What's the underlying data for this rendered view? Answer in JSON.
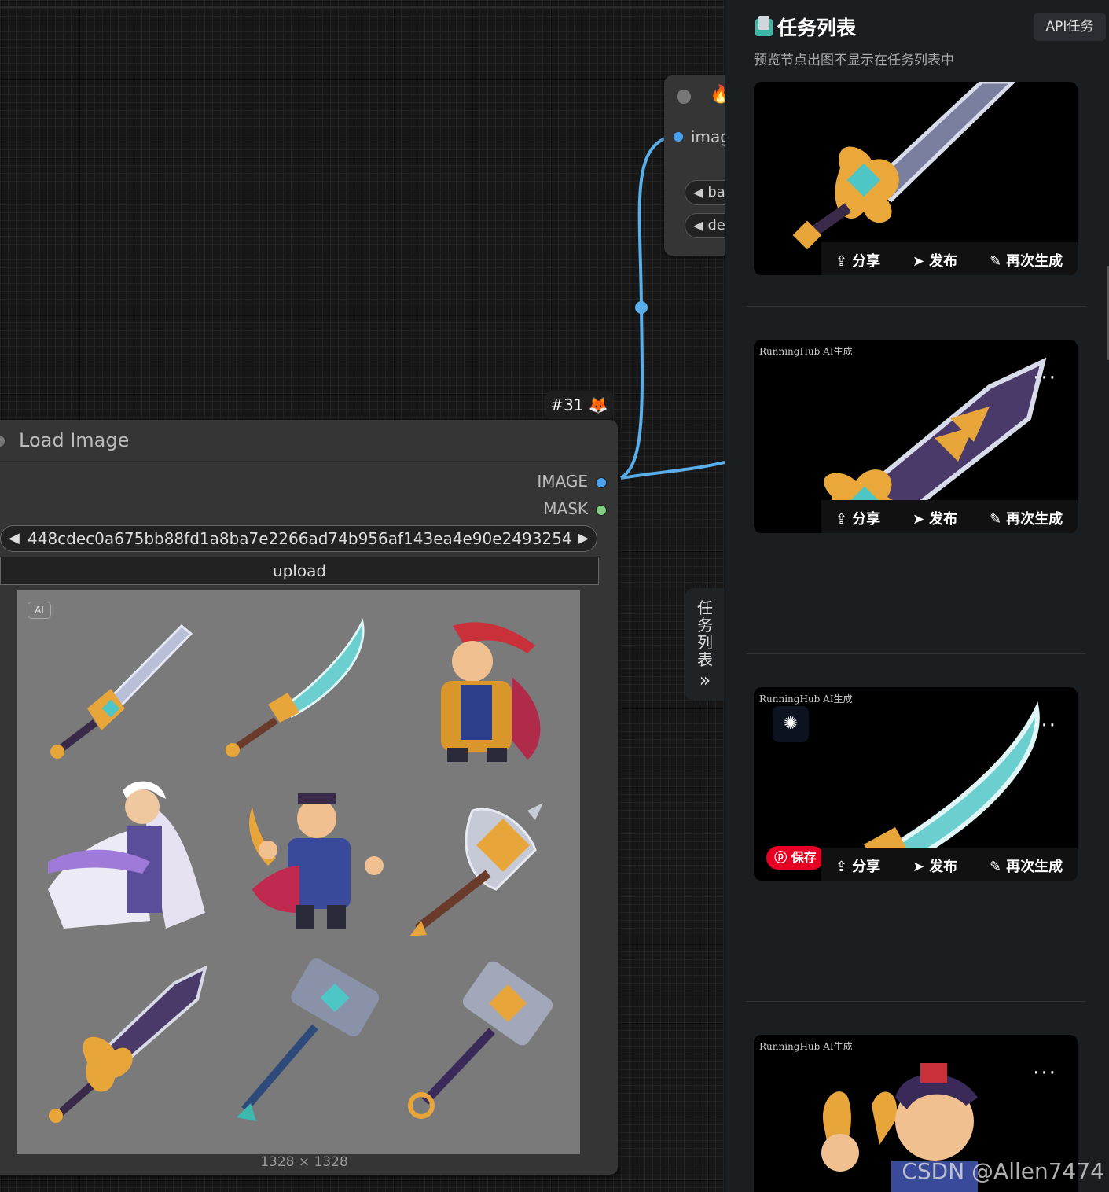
{
  "canvas": {
    "top_node": {
      "input_label": "imag",
      "pill1": "ba",
      "pill2": "de"
    },
    "node_badge": "#31 🦊",
    "load_image": {
      "title": "Load Image",
      "outputs": [
        {
          "label": "IMAGE",
          "color": "#4aa3f0"
        },
        {
          "label": "MASK",
          "color": "#7fcf7f"
        }
      ],
      "filename": "448cdec0a675bb88fd1a8ba7e2266ad74b956af143ea4e90e2493254",
      "filename_ellipsis": "...",
      "upload_label": "upload",
      "ai_badge": "AI",
      "dimensions": "1328 × 1328"
    },
    "side_tab": {
      "label": "任务列表",
      "chars": [
        "任",
        "务",
        "列",
        "表"
      ],
      "chevron": "»"
    }
  },
  "panel": {
    "title": "任务列表",
    "api_button": "API任务",
    "subtitle": "预览节点出图不显示在任务列表中",
    "brand_text": "RunningHub AI生成",
    "actions": {
      "share": "分享",
      "publish": "发布",
      "regenerate": "再次生成"
    },
    "save_label": "保存",
    "more": "···"
  },
  "watermark": "CSDN @Allen7474"
}
